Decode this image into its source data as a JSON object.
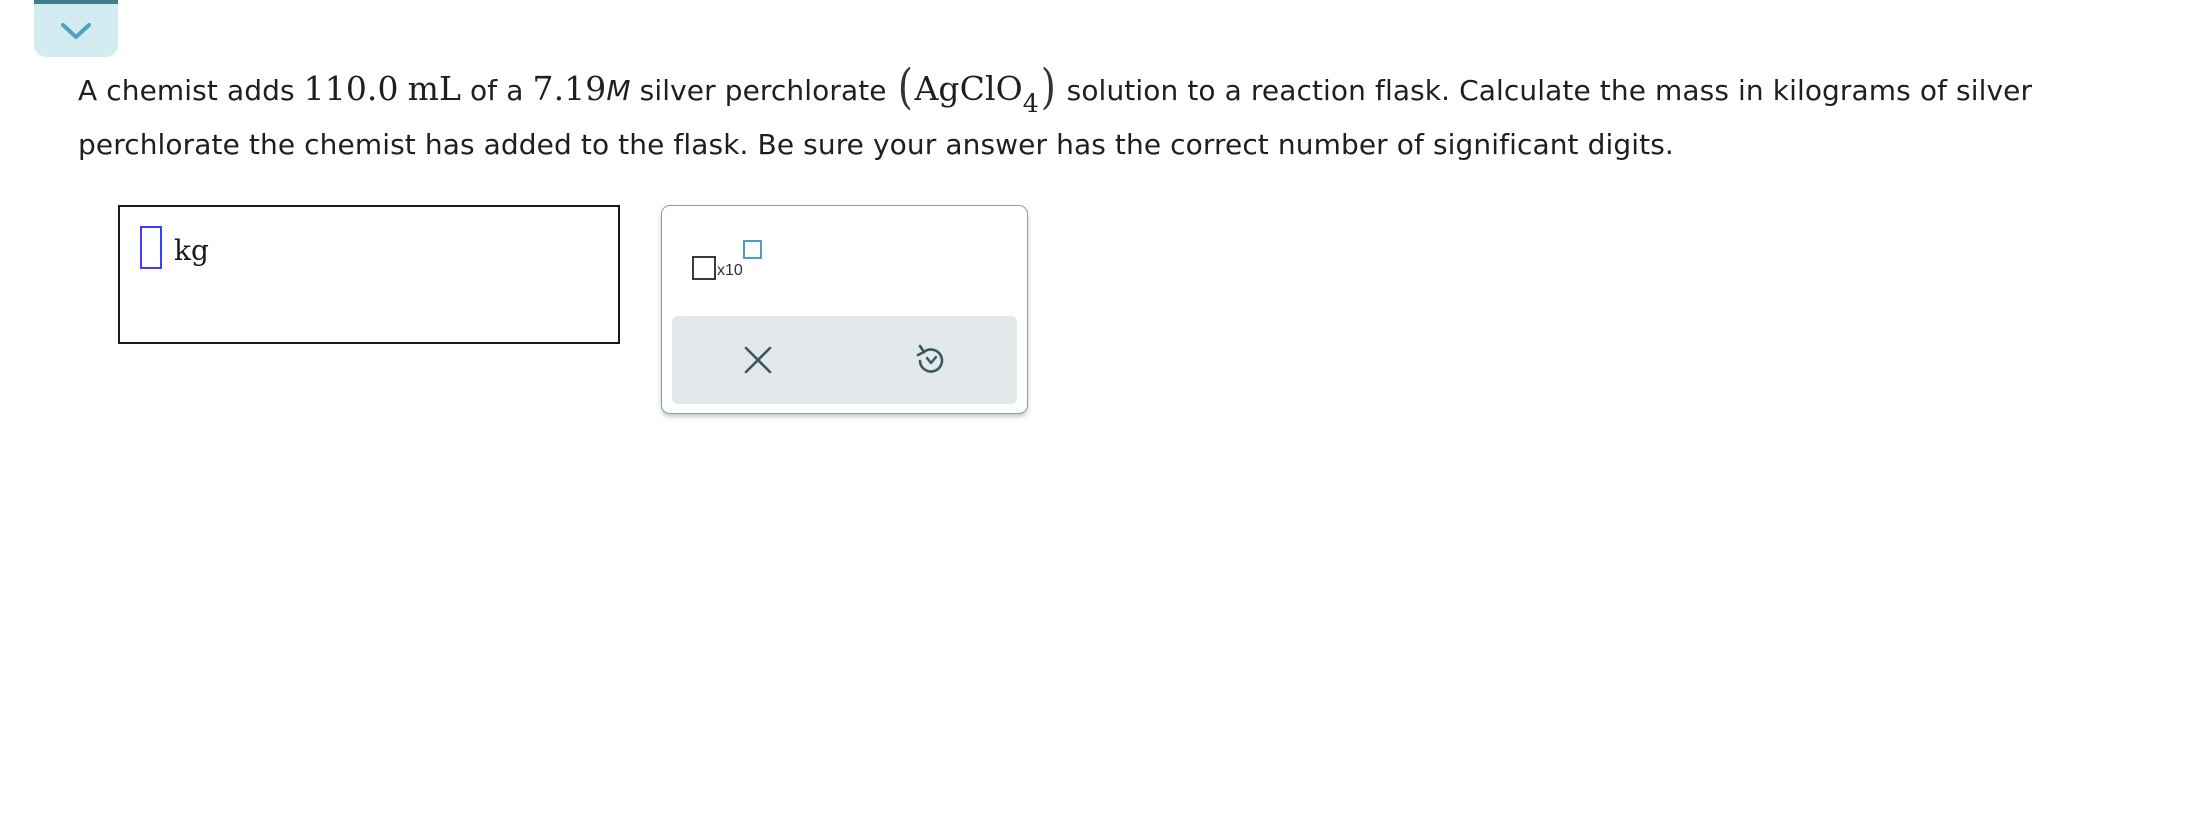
{
  "question": {
    "part1": "A chemist adds ",
    "volume": "110.0",
    "volume_unit": "mL",
    "part2": " of a ",
    "concentration": "7.19",
    "concentration_unit": "M",
    "part3": " silver perchlorate ",
    "formula_main": "AgClO",
    "formula_sub": "4",
    "part4": " solution to a reaction flask. Calculate the mass in kilograms of silver perchlorate the chemist has added to the flask. Be sure your answer has the correct number of significant digits."
  },
  "answer": {
    "value": "",
    "unit": "kg"
  },
  "keypad": {
    "sci_notation_label": "x10"
  },
  "icons": {
    "collapse": "chevron-down-icon",
    "clear": "close-icon",
    "undo": "undo-icon"
  },
  "colors": {
    "tab_background": "#d4ebf1",
    "tab_accent": "#3f7d8f",
    "chevron": "#4da3c2",
    "input_cursor_border": "#3d3dff",
    "exponent_box": "#4d9fc0",
    "action_bar": "#e3e8eb",
    "action_icon": "#3b5663"
  }
}
